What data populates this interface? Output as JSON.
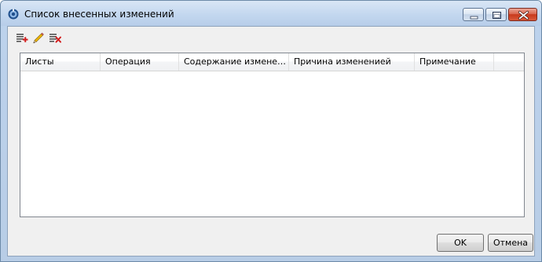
{
  "window": {
    "title": "Список внесенных изменений",
    "controls": {
      "minimize": "minimize-icon",
      "maximize": "maximize-icon",
      "close": "close-icon"
    }
  },
  "toolbar": {
    "buttons": [
      {
        "icon": "add-row-icon"
      },
      {
        "icon": "pencil-edit-icon"
      },
      {
        "icon": "delete-row-icon"
      }
    ]
  },
  "table": {
    "columns": [
      "Листы",
      "Операция",
      "Содержание изменен...",
      "Причина измененией",
      "Примечание"
    ],
    "rows": []
  },
  "buttons": {
    "ok": "OK",
    "cancel": "Отмена"
  },
  "colors": {
    "accent": "#c8391c",
    "title_bar": "#c3d7ef",
    "client": "#f0f0f0"
  }
}
